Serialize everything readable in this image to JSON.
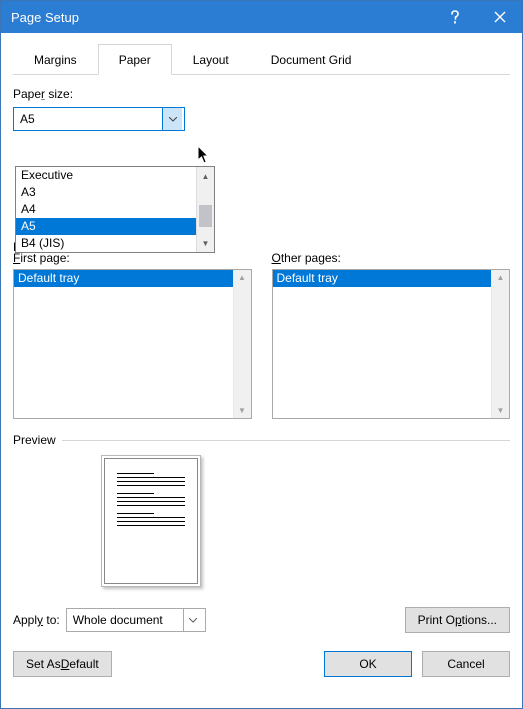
{
  "window": {
    "title": "Page Setup"
  },
  "tabs": {
    "margins": "Margins",
    "paper": "Paper",
    "layout": "Layout",
    "grid": "Document Grid"
  },
  "paper_size": {
    "label": "Paper size:",
    "value": "A5",
    "options": {
      "o0": "Executive",
      "o1": "A3",
      "o2": "A4",
      "o3": "A5",
      "o4": "B4 (JIS)"
    }
  },
  "paper_source": {
    "truncated_label": "Pa",
    "first_label": "First page:",
    "other_label": "Other pages:",
    "first_value": "Default tray",
    "other_value": "Default tray"
  },
  "preview": {
    "label": "Preview"
  },
  "apply": {
    "label": "Apply to:",
    "value": "Whole document"
  },
  "buttons": {
    "print_options": "Print Options...",
    "set_default": "Set As Default",
    "ok": "OK",
    "cancel": "Cancel"
  }
}
